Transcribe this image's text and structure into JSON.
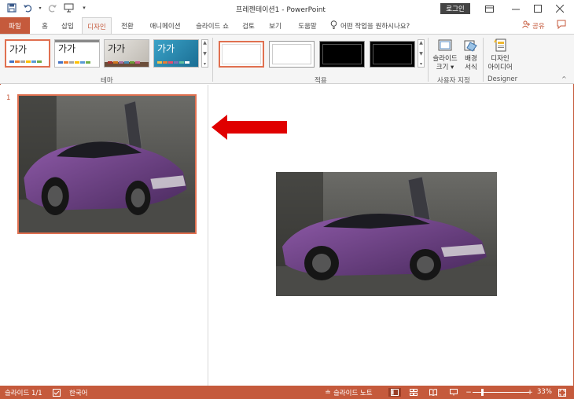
{
  "window": {
    "doc_title": "프레젠테이션1  -  PowerPoint",
    "login_label": "로그인",
    "accent": "#c55a3c"
  },
  "qat": [
    "save-icon",
    "undo-icon",
    "redo-icon",
    "slideshow-from-start-icon",
    "customize-icon"
  ],
  "tabs": [
    {
      "label": "파일",
      "kind": "file"
    },
    {
      "label": "홈"
    },
    {
      "label": "삽입"
    },
    {
      "label": "디자인",
      "active": true
    },
    {
      "label": "전환"
    },
    {
      "label": "애니메이션"
    },
    {
      "label": "슬라이드 쇼"
    },
    {
      "label": "검토"
    },
    {
      "label": "보기"
    },
    {
      "label": "도움말"
    }
  ],
  "tellme": "어떤 작업을 원하시나요?",
  "share": "공유",
  "ribbon": {
    "themes": [
      {
        "label": "가가",
        "selected": true
      },
      {
        "label": "가가"
      },
      {
        "label": "가가"
      },
      {
        "label": "가가"
      }
    ],
    "theme_group_label": "테마",
    "variants_group_label": "적용",
    "slide_size": "슬라이드\n크기 ▾",
    "bg_format": "배경\n서식",
    "customize_group_label": "사용자 지정",
    "design_ideas": "디자인\n아이디어",
    "designer_group_label": "Designer"
  },
  "thumbnails": [
    {
      "number": "1"
    }
  ],
  "status": {
    "slide_info": "슬라이드 1/1",
    "language": "한국어",
    "notes": "슬라이드 노트",
    "zoom": "33%",
    "zoom_level": 0.33
  }
}
